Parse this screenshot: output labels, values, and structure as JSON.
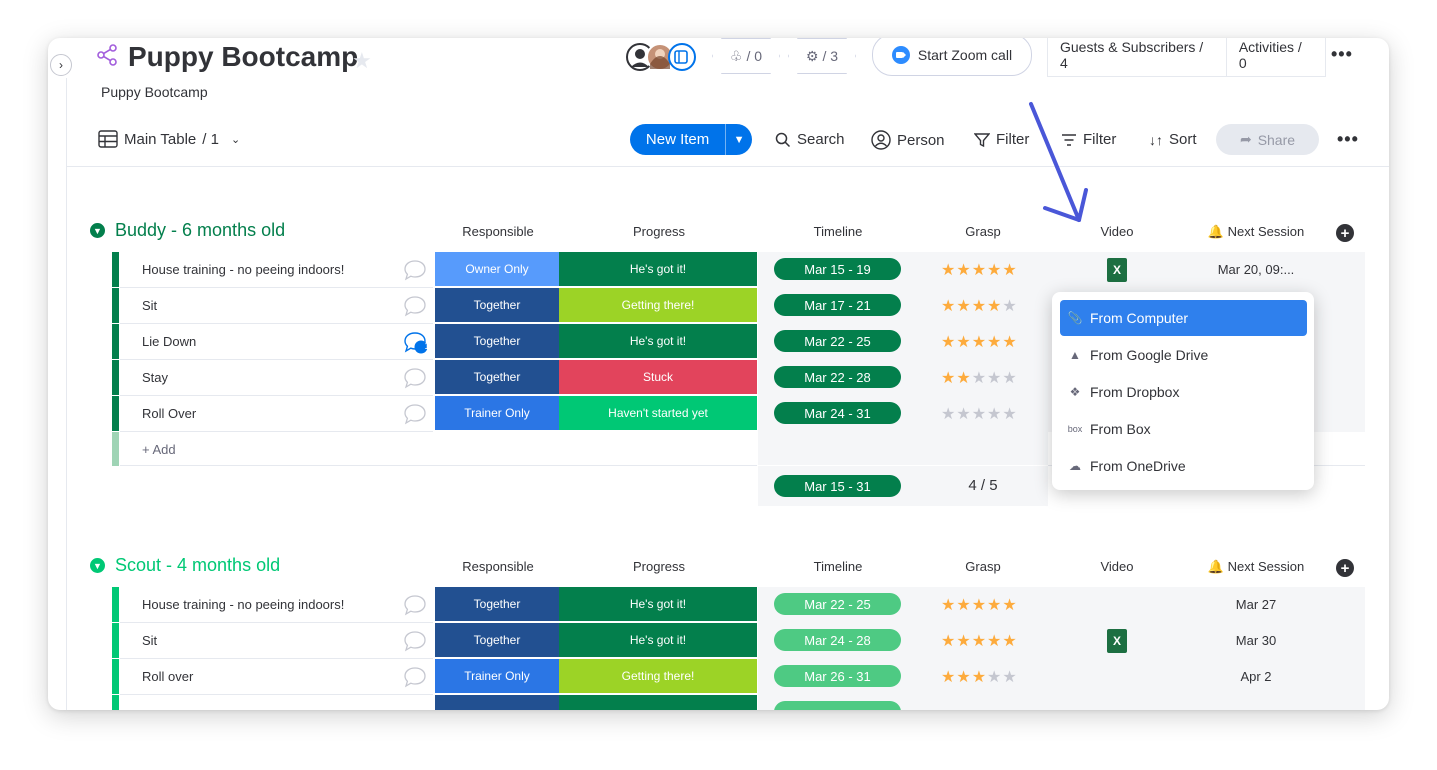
{
  "board": {
    "title": "Puppy Bootcamp",
    "subtitle": "Puppy Bootcamp"
  },
  "header": {
    "updates_count": "/ 0",
    "integrations_count": "/ 3",
    "zoom_label": "Start Zoom call",
    "guests_label": "Guests & Subscribers / 4",
    "activities_label": "Activities / 0"
  },
  "toolbar": {
    "view_label": "Main Table",
    "view_count": "/ 1",
    "new_item": "New Item",
    "search": "Search",
    "person": "Person",
    "filter1": "Filter",
    "filter2": "Filter",
    "sort": "Sort",
    "share": "Share"
  },
  "columns": [
    "Responsible",
    "Progress",
    "Timeline",
    "Grasp",
    "Video",
    "Next Session"
  ],
  "groups": [
    {
      "title": "Buddy - 6 months old",
      "color": "#037f4c",
      "add_label": "+ Add",
      "summary": {
        "timeline": "Mar 15 - 31",
        "grasp": "4 / 5"
      },
      "rows": [
        {
          "name": "House training - no peeing indoors!",
          "responsible": "Owner Only",
          "resp_color": "#579bfc",
          "progress": "He's got it!",
          "prog_color": "#037f4c",
          "timeline": "Mar 15 - 19",
          "grasp": 5,
          "video": "X",
          "next": "Mar 20, 09:...",
          "comments": ""
        },
        {
          "name": "Sit",
          "responsible": "Together",
          "resp_color": "#225091",
          "progress": "Getting there!",
          "prog_color": "#9cd326",
          "timeline": "Mar 17 - 21",
          "grasp": 4,
          "video": "",
          "next": "",
          "comments": ""
        },
        {
          "name": "Lie Down",
          "responsible": "Together",
          "resp_color": "#225091",
          "progress": "He's got it!",
          "prog_color": "#037f4c",
          "timeline": "Mar 22 - 25",
          "grasp": 5,
          "video": "",
          "next": "",
          "comments": "1"
        },
        {
          "name": "Stay",
          "responsible": "Together",
          "resp_color": "#225091",
          "progress": "Stuck",
          "prog_color": "#e2445c",
          "timeline": "Mar 22 - 28",
          "grasp": 2,
          "video": "",
          "next": "",
          "comments": ""
        },
        {
          "name": "Roll Over",
          "responsible": "Trainer Only",
          "resp_color": "#2b76e5",
          "progress": "Haven't started yet",
          "prog_color": "#00c875",
          "timeline": "Mar 24 - 31",
          "grasp": 0,
          "video": "",
          "next": "",
          "comments": ""
        }
      ]
    },
    {
      "title": "Scout - 4 months old",
      "color": "#00c875",
      "rows": [
        {
          "name": "House training - no peeing indoors!",
          "responsible": "Together",
          "resp_color": "#225091",
          "progress": "He's got it!",
          "prog_color": "#037f4c",
          "timeline": "Mar 22 - 25",
          "grasp": 5,
          "video": "",
          "next": "Mar 27"
        },
        {
          "name": "Sit",
          "responsible": "Together",
          "resp_color": "#225091",
          "progress": "He's got it!",
          "prog_color": "#037f4c",
          "timeline": "Mar 24 - 28",
          "grasp": 5,
          "video": "X",
          "next": "Mar 30"
        },
        {
          "name": "Roll over",
          "responsible": "Trainer Only",
          "resp_color": "#2b76e5",
          "progress": "Getting there!",
          "prog_color": "#9cd326",
          "timeline": "Mar 26 - 31",
          "grasp": 3,
          "video": "",
          "next": "Apr 2"
        }
      ]
    }
  ],
  "upload_menu": {
    "items": [
      {
        "label": "From Computer",
        "icon": "paperclip-icon"
      },
      {
        "label": "From Google Drive",
        "icon": "google-drive-icon"
      },
      {
        "label": "From Dropbox",
        "icon": "dropbox-icon"
      },
      {
        "label": "From Box",
        "icon": "box-icon"
      },
      {
        "label": "From OneDrive",
        "icon": "onedrive-icon"
      }
    ]
  },
  "colors": {
    "primary": "#0073ea",
    "arrow": "#4a57d8",
    "menu_highlight": "#2f80ed"
  }
}
